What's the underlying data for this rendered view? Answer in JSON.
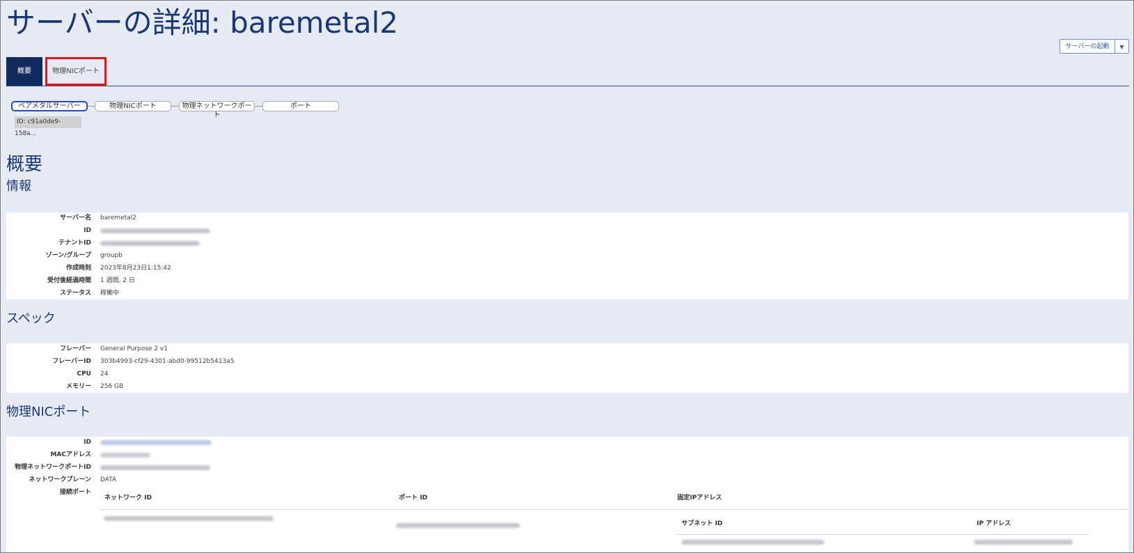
{
  "page": {
    "title": "サーバーの詳細: baremetal2"
  },
  "actions": {
    "start_label": "サーバーの起動"
  },
  "tabs": [
    {
      "label": "概要"
    },
    {
      "label": "物理NICポート"
    }
  ],
  "breadcrumbs": [
    {
      "label": "ベアメタルサーバー"
    },
    {
      "label": "物理NICポート"
    },
    {
      "label": "物理ネットワークポート"
    },
    {
      "label": "ポート"
    }
  ],
  "breadcrumb_id": "ID: c91a0de9-158a...",
  "overview": {
    "heading": "概要",
    "info_heading": "情報",
    "info_rows": [
      {
        "label": "サーバー名",
        "value": "baremetal2"
      },
      {
        "label": "ID",
        "value": ""
      },
      {
        "label": "テナントID",
        "value": ""
      },
      {
        "label": "ゾーン/グループ",
        "value": "groupb"
      },
      {
        "label": "作成時刻",
        "value": "2023年8月23日1:15:42"
      },
      {
        "label": "受付後経過時間",
        "value": "1 週間, 2 日"
      },
      {
        "label": "ステータス",
        "value": "稼働中"
      }
    ],
    "spec_heading": "スペック",
    "spec_rows": [
      {
        "label": "フレーバー",
        "value": "General Purpose 2 v1"
      },
      {
        "label": "フレーバーID",
        "value": "303b4993-cf29-4301-abd0-99512b5413a5"
      },
      {
        "label": "CPU",
        "value": "24"
      },
      {
        "label": "メモリー",
        "value": "256 GB"
      }
    ],
    "nic_heading": "物理NICポート",
    "nic_rows": [
      {
        "label": "ID",
        "value": ""
      },
      {
        "label": "MACアドレス",
        "value": ""
      },
      {
        "label": "物理ネットワークポートID",
        "value": ""
      },
      {
        "label": "ネットワークプレーン",
        "value": "DATA"
      },
      {
        "label": "接続ポート",
        "value": ""
      }
    ],
    "attached_ports_table": {
      "columns": [
        "ネットワーク ID",
        "ポート ID",
        "固定IPアドレス"
      ],
      "sub_columns": [
        "サブネット ID",
        "IP アドレス"
      ]
    }
  }
}
